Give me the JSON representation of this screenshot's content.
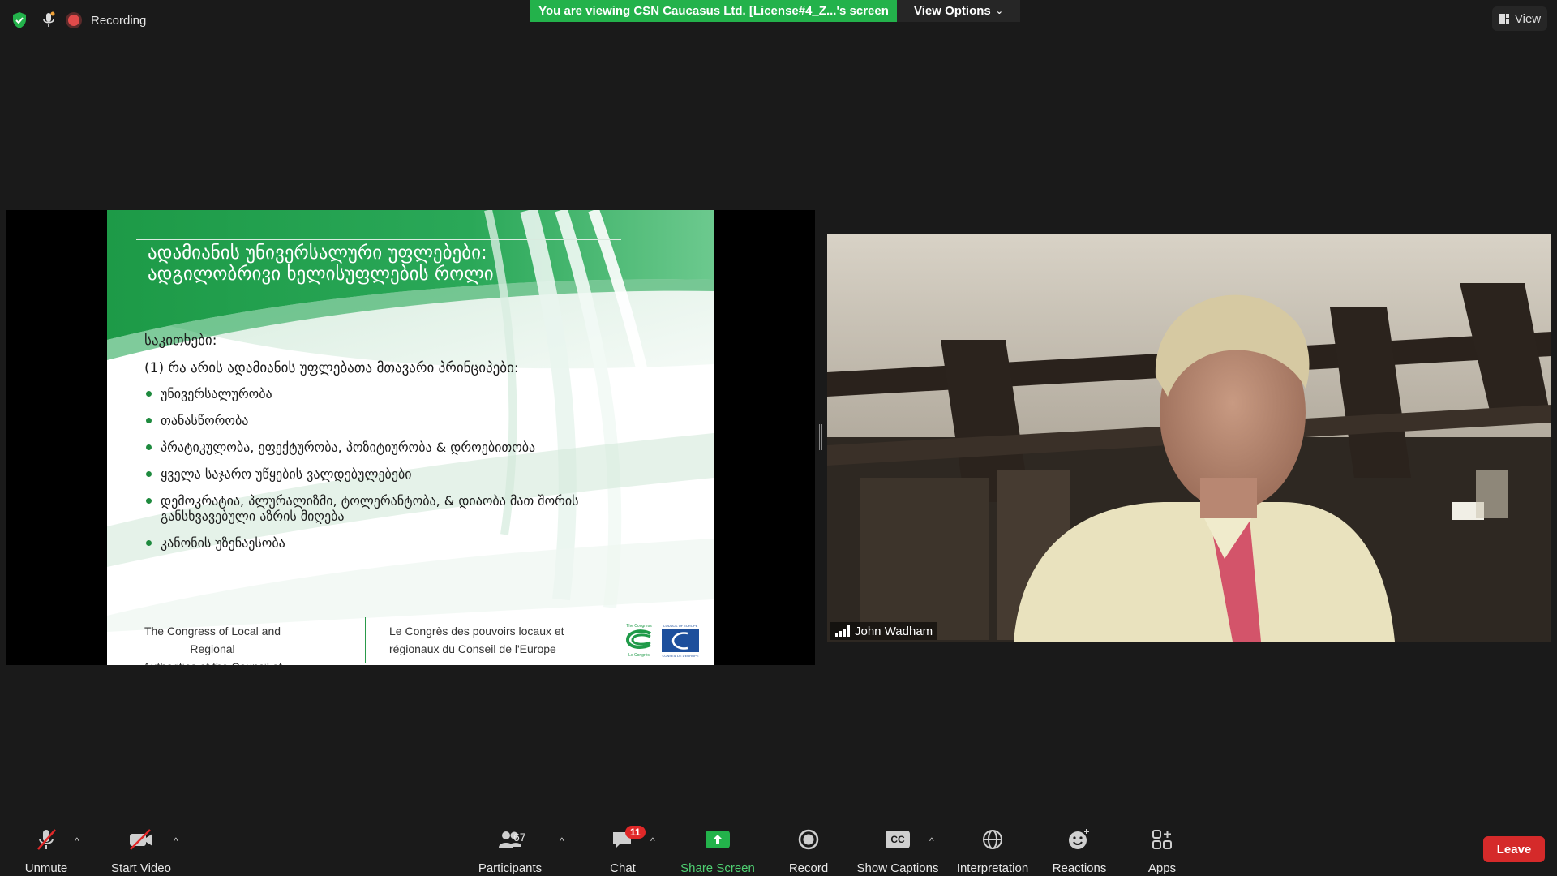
{
  "top": {
    "recording_label": "Recording",
    "banner_text": "You are viewing CSN Caucasus Ltd. [License#4_Z...'s screen",
    "view_options_label": "View Options",
    "view_label": "View"
  },
  "slide": {
    "title_line1": "ადამიანის უნივერსალური უფლებები:",
    "title_line2": "ადგილობრივი ხელისუფლების როლი",
    "subtitle": "საკითხები:",
    "question": "(1) რა არის ადამიანის უფლებათა მთავარი პრინციპები:",
    "bullets": [
      "უნივერსალურობა",
      "თანასწორობა",
      "პრატიკულობა, ეფექტურობა, პოზიტიურობა & დროებითობა",
      "ყველა საჯარო უწყების ვალდებულებები",
      "დემოკრატია, პლურალიზმი, ტოლერანტობა, & დიაობა მათ შორის განსხვავებული აზრის მიღება",
      "კანონის უზენაესობა"
    ],
    "footer_left_line1": "The Congress of Local and Regional",
    "footer_left_line2": "Authorities of the Council of Europe",
    "footer_right_line1": "Le Congrès des pouvoirs locaux et",
    "footer_right_line2": "régionaux du Conseil de l'Europe",
    "logo_congress_top": "The Congress",
    "logo_congress_bottom": "Le Congrès",
    "logo_coe_top": "COUNCIL OF EUROPE",
    "logo_coe_bottom": "CONSEIL DE L'EUROPE",
    "green": "#1f9a48"
  },
  "video": {
    "participant_name": "John Wadham"
  },
  "toolbar": {
    "unmute": "Unmute",
    "start_video": "Start Video",
    "participants": "Participants",
    "participants_count": "67",
    "chat": "Chat",
    "chat_badge": "11",
    "share_screen": "Share Screen",
    "record": "Record",
    "show_captions": "Show Captions",
    "cc": "CC",
    "interpretation": "Interpretation",
    "reactions": "Reactions",
    "apps": "Apps",
    "leave": "Leave"
  }
}
